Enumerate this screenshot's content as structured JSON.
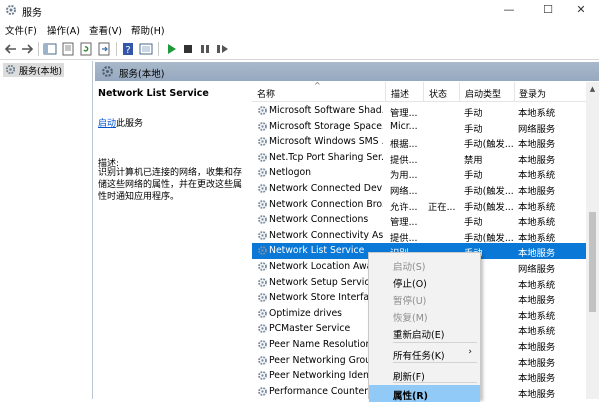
{
  "window": {
    "title": "服务",
    "min": "—",
    "max": "☐",
    "close": "✕"
  },
  "menu": [
    "文件(F)",
    "操作(A)",
    "查看(V)",
    "帮助(H)"
  ],
  "tree": {
    "node": "服务(本地)"
  },
  "main": {
    "header": "服务(本地)"
  },
  "details": {
    "name": "Network List Service",
    "start_link": "启动",
    "start_suffix": "此服务",
    "desc_label": "描述:",
    "desc_text": "识别计算机已连接的网络，收集和存储这些网络的属性，并在更改这些属性时通知应用程序。"
  },
  "columns": {
    "name": "名称",
    "desc": "描述",
    "status": "状态",
    "startup": "启动类型",
    "logon": "登录为"
  },
  "services": [
    {
      "name": "Microsoft Software Shad...",
      "desc": "管理...",
      "status": "",
      "startup": "手动",
      "logon": "本地系统"
    },
    {
      "name": "Microsoft Storage Space...",
      "desc": "Micr...",
      "status": "",
      "startup": "手动",
      "logon": "网络服务"
    },
    {
      "name": "Microsoft Windows SMS ...",
      "desc": "根据...",
      "status": "",
      "startup": "手动(触发...",
      "logon": "本地服务"
    },
    {
      "name": "Net.Tcp Port Sharing Ser...",
      "desc": "提供...",
      "status": "",
      "startup": "禁用",
      "logon": "本地服务"
    },
    {
      "name": "Netlogon",
      "desc": "为用...",
      "status": "",
      "startup": "手动",
      "logon": "本地系统"
    },
    {
      "name": "Network Connected Devi...",
      "desc": "网络...",
      "status": "",
      "startup": "手动(触发...",
      "logon": "本地服务"
    },
    {
      "name": "Network Connection Bro...",
      "desc": "允许...",
      "status": "正在...",
      "startup": "手动(触发...",
      "logon": "本地系统"
    },
    {
      "name": "Network Connections",
      "desc": "管理...",
      "status": "",
      "startup": "手动",
      "logon": "本地系统"
    },
    {
      "name": "Network Connectivity Ass...",
      "desc": "提供...",
      "status": "",
      "startup": "手动(触发...",
      "logon": "本地系统"
    },
    {
      "name": "Network List Service",
      "desc": "识别...",
      "status": "",
      "startup": "手动",
      "logon": "本地服务",
      "selected": true
    },
    {
      "name": "Network Location Awa",
      "desc": "",
      "status": "",
      "startup": "",
      "logon": "网络服务"
    },
    {
      "name": "Network Setup Service",
      "desc": "",
      "status": "",
      "startup": "",
      "logon": "本地系统"
    },
    {
      "name": "Network Store Interfac",
      "desc": "",
      "status": "",
      "startup": "",
      "logon": "本地服务"
    },
    {
      "name": "Optimize drives",
      "desc": "",
      "status": "",
      "startup": "",
      "logon": "本地系统"
    },
    {
      "name": "PCMaster Service",
      "desc": "",
      "status": "",
      "startup": "",
      "logon": "本地系统"
    },
    {
      "name": "Peer Name Resolution",
      "desc": "",
      "status": "",
      "startup": "",
      "logon": "本地服务"
    },
    {
      "name": "Peer Networking Grou",
      "desc": "",
      "status": "",
      "startup": "",
      "logon": "本地服务"
    },
    {
      "name": "Peer Networking Ident",
      "desc": "",
      "status": "",
      "startup": "",
      "logon": "本地服务"
    },
    {
      "name": "Performance Counter I",
      "desc": "",
      "status": "",
      "startup": "",
      "logon": "本地服务"
    }
  ],
  "context_menu": {
    "items": [
      {
        "label": "启动(S)",
        "disabled": true
      },
      {
        "label": "停止(O)",
        "disabled": false
      },
      {
        "label": "暂停(U)",
        "disabled": true
      },
      {
        "label": "恢复(M)",
        "disabled": true
      },
      {
        "label": "重新启动(E)",
        "disabled": false
      },
      {
        "label": "所有任务(K)",
        "submenu": true,
        "disabled": false
      },
      {
        "label": "刷新(F)",
        "disabled": false
      },
      {
        "label": "属性(R)",
        "disabled": false,
        "highlighted": true,
        "bold": true
      }
    ],
    "submenu_arrow": "›"
  },
  "colors": {
    "selection": "#0a78d7",
    "header_bar": "#97a9c0",
    "menu_highlight": "#91c9f7",
    "link": "#0055cc"
  }
}
